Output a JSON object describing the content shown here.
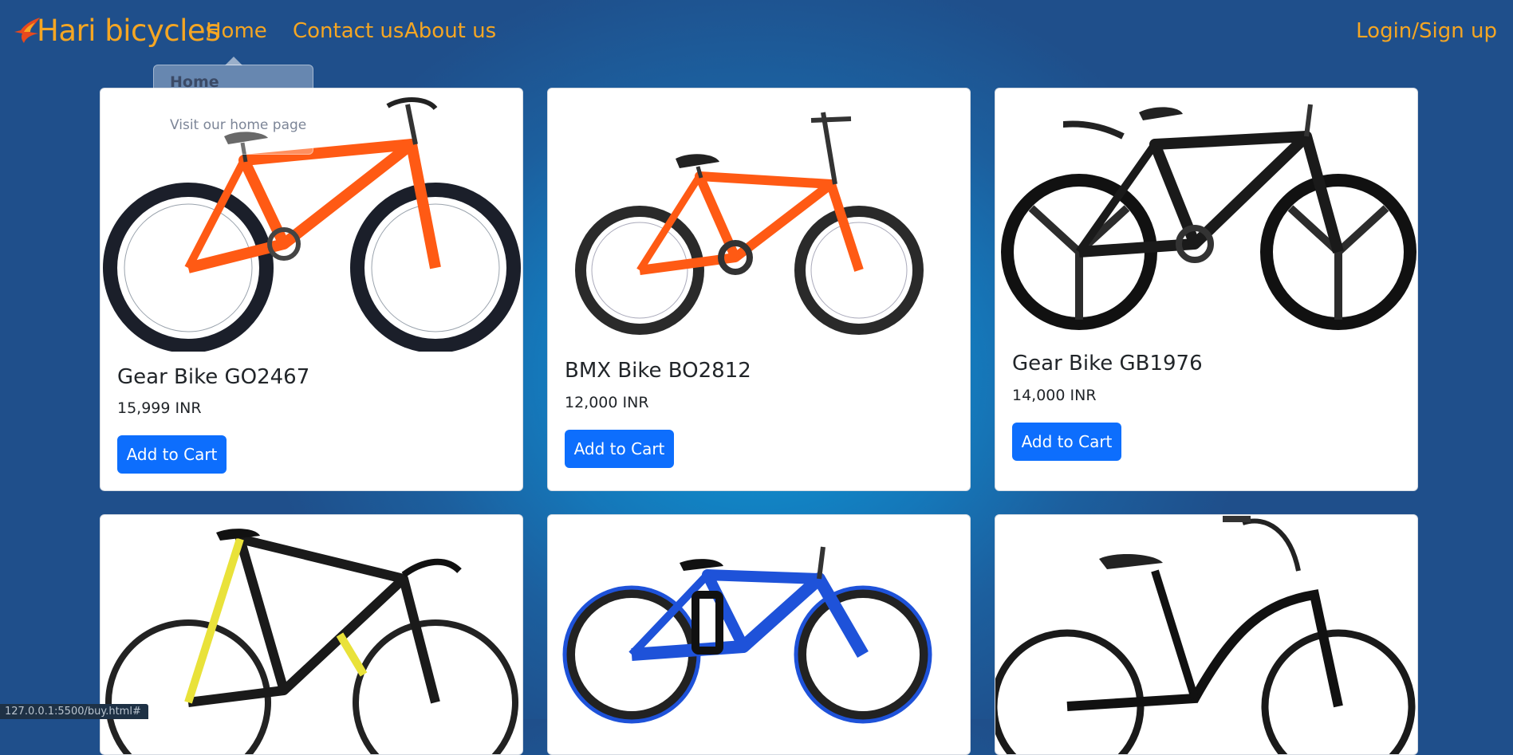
{
  "nav": {
    "brand": "Hari bicycles",
    "links": [
      "Home",
      "Contact us",
      "About us"
    ],
    "login": "Login/Sign up"
  },
  "popover": {
    "title": "Home",
    "body": "Visit our home page"
  },
  "products": [
    {
      "title": "Gear Bike GO2467",
      "price": "15,999 INR",
      "button": "Add to Cart"
    },
    {
      "title": "BMX Bike BO2812",
      "price": "12,000 INR",
      "button": "Add to Cart"
    },
    {
      "title": "Gear Bike GB1976",
      "price": "14,000 INR",
      "button": "Add to Cart"
    }
  ],
  "status_url": "127.0.0.1:5500/buy.html#",
  "colors": {
    "accent": "#f5a623",
    "button": "#0d6efd"
  },
  "icons": [
    "flame-logo-icon",
    "bicycle-image"
  ]
}
